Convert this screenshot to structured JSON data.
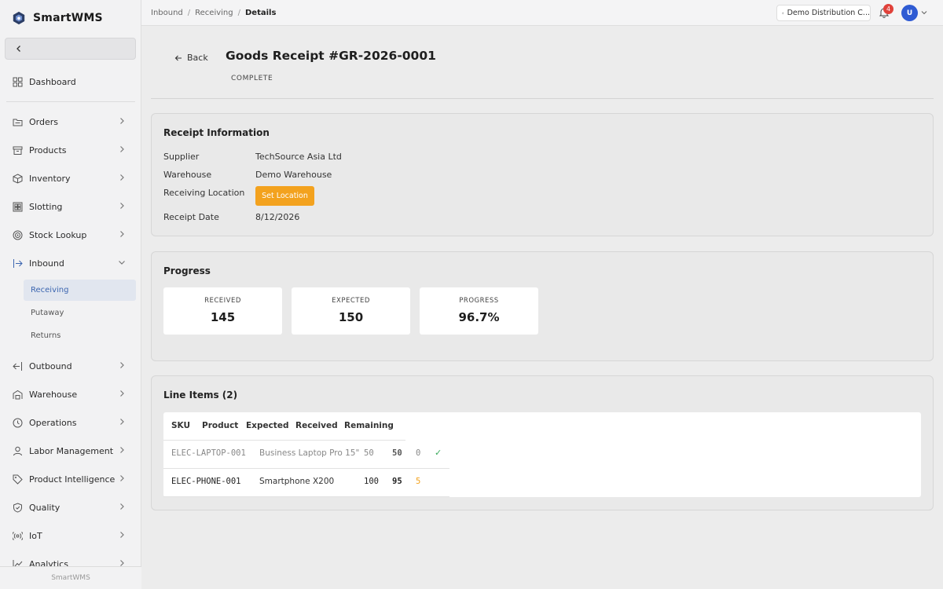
{
  "app": {
    "name": "SmartWMS",
    "footer": "SmartWMS"
  },
  "colors": {
    "accent": "#3c66b0",
    "warning": "#f3a21e",
    "success": "#3aaa5c",
    "badge": "#e0413a",
    "avatar": "#2f5bd3"
  },
  "sidebar": {
    "items": [
      {
        "label": "Dashboard",
        "icon": "grid-icon"
      },
      {
        "label": "Orders",
        "icon": "folder-icon"
      },
      {
        "label": "Products",
        "icon": "box-icon"
      },
      {
        "label": "Inventory",
        "icon": "cube-icon"
      },
      {
        "label": "Slotting",
        "icon": "layout-icon"
      },
      {
        "label": "Stock Lookup",
        "icon": "target-icon"
      },
      {
        "label": "Inbound",
        "icon": "arrow-in-icon"
      },
      {
        "label": "Outbound",
        "icon": "arrow-out-icon"
      },
      {
        "label": "Warehouse",
        "icon": "warehouse-icon"
      },
      {
        "label": "Operations",
        "icon": "clock-icon"
      },
      {
        "label": "Labor Management",
        "icon": "user-icon"
      },
      {
        "label": "Product Intelligence",
        "icon": "tag-icon"
      },
      {
        "label": "Quality",
        "icon": "shield-icon"
      },
      {
        "label": "IoT",
        "icon": "signal-icon"
      },
      {
        "label": "Analytics",
        "icon": "chart-icon"
      }
    ],
    "inbound_sub": [
      "Receiving",
      "Putaway",
      "Returns"
    ]
  },
  "breadcrumb": [
    "Inbound",
    "Receiving",
    "Details"
  ],
  "header": {
    "location": "Demo Distribution C...",
    "notifications": "4",
    "avatar_initial": "U"
  },
  "page": {
    "back_label": "Back",
    "title": "Goods Receipt #GR-2026-0001",
    "status": "COMPLETE"
  },
  "receipt": {
    "title": "Receipt Information",
    "supplier_label": "Supplier",
    "supplier": "TechSource Asia Ltd",
    "warehouse_label": "Warehouse",
    "warehouse": "Demo Warehouse",
    "location_label": "Receiving Location",
    "set_location": "Set Location",
    "date_label": "Receipt Date",
    "date": "8/12/2026"
  },
  "progress": {
    "title": "Progress",
    "received_label": "RECEIVED",
    "received": "145",
    "expected_label": "EXPECTED",
    "expected": "150",
    "progress_label": "PROGRESS",
    "progress": "96.7%"
  },
  "lines": {
    "title": "Line Items (2)",
    "headers": [
      "SKU",
      "Product",
      "Expected",
      "Received",
      "Remaining"
    ],
    "rows": [
      {
        "sku": "ELEC-LAPTOP-001",
        "product": "Business Laptop Pro 15\"",
        "expected": "50",
        "received": "50",
        "remaining": "0",
        "check": "✓"
      },
      {
        "sku": "ELEC-PHONE-001",
        "product": "Smartphone X200",
        "expected": "100",
        "received": "95",
        "remaining": "5"
      }
    ]
  }
}
